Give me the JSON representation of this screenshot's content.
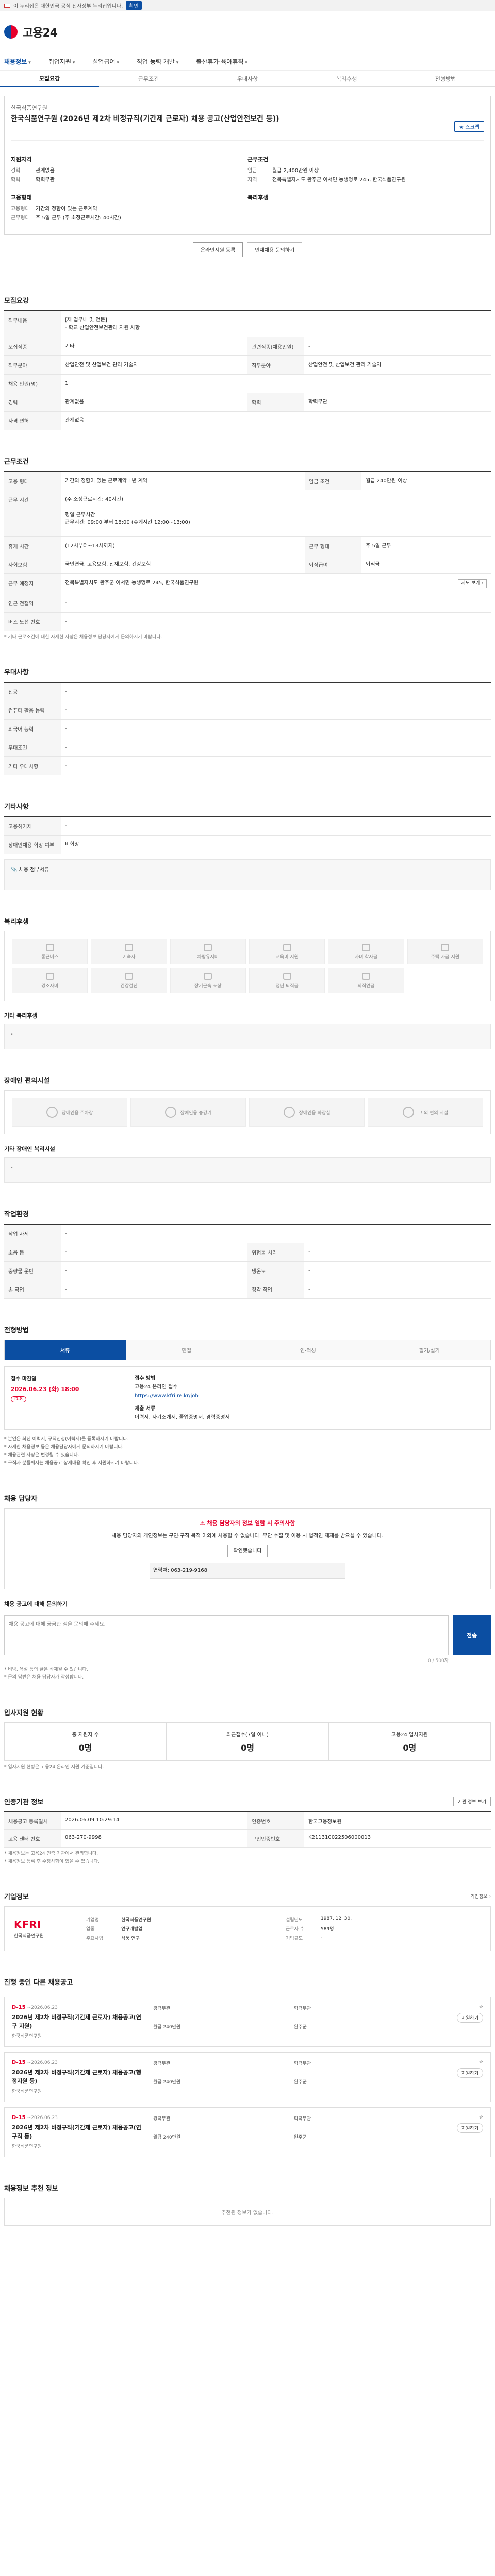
{
  "banner": {
    "text": "이 누리집은 대한민국 공식 전자정부 누리집입니다.",
    "button": "확인"
  },
  "logo": {
    "text": "고용24"
  },
  "gnb": [
    "채용정보",
    "취업지원",
    "실업급여",
    "직업 능력 개발",
    "출산휴가·육아휴직"
  ],
  "tabs": [
    "모집요강",
    "근무조건",
    "우대사항",
    "복리후생",
    "전형방법"
  ],
  "title": {
    "company": "한국식품연구원",
    "text": "한국식품연구원 (2026년 제2차 비정규직(기간제 근로자) 채용 공고(산업안전보건 등))",
    "scrap": "★ 스크랩"
  },
  "summary": {
    "recruit_h": "지원자격",
    "recruit": [
      {
        "k": "경력",
        "v": "관계없음"
      },
      {
        "k": "학력",
        "v": "학력무관"
      }
    ],
    "cond_h": "근무조건",
    "cond": [
      {
        "k": "임금",
        "v": "월급 2,400만원 이상"
      },
      {
        "k": "지역",
        "v": "전북특별자치도 완주군 이서면 농생명로 245, 한국식품연구원"
      }
    ],
    "emp_h": "고용형태",
    "emp": [
      {
        "k": "고용형태",
        "v": "기간의 정함이 있는 근로계약"
      },
      {
        "k": "근무형태",
        "v": "주 5일 근무 (주 소정근로시간: 40시간)"
      }
    ],
    "welfare_h": "복리후생",
    "welfare": []
  },
  "buttons": {
    "apply": "온라인지원 등록",
    "inquire": "인재채용 문의하기"
  },
  "recruit": {
    "heading": "모집요강",
    "duty_label": "직무내용",
    "duty": "[제 업무내 및 전문]\n- 학교 산업안전보건관리 지원 사항",
    "rows": [
      {
        "k": "모집직종",
        "v": "기타",
        "k2": "관련직종(채용인원)",
        "v2": "-"
      },
      {
        "k": "직무분야",
        "v": "산업안전 및 산업보건 관리 기술자",
        "k2": "직무분야",
        "v2": "산업안전 및 산업보건 관리 기술자"
      },
      {
        "k": "채용 인원(명)",
        "v": "1",
        "k2": "",
        "v2": ""
      },
      {
        "k": "경력",
        "v": "관계없음",
        "k2": "학력",
        "v2": "학력무관"
      },
      {
        "k": "자격 면허",
        "v": "관계없음",
        "k2": "",
        "v2": ""
      }
    ]
  },
  "work": {
    "heading": "근무조건",
    "rows": [
      {
        "k": "고용 형태",
        "v": "기간의 정함이 있는 근로계약 1년 계약",
        "k2": "임금 조건",
        "v2": "월급 240만원 이상"
      },
      {
        "k": "근무 시간",
        "v": "(주 소정근로시간: 40시간)\n\n평일 근무시간\n근무시간: 09:00 부터 18:00 (휴게시간 12:00~13:00)"
      },
      {
        "k": "휴게 시간",
        "v": "(12시부터~13시까지)",
        "k2": "근무 형태",
        "v2": "주 5일 근무"
      },
      {
        "k": "사회보험",
        "v": "국민연금, 고용보험, 산재보험, 건강보험",
        "k2": "퇴직급여",
        "v2": "퇴직금"
      },
      {
        "k": "근무 예정지",
        "v": "전북특별자치도 완주군 이서면 농생명로 245, 한국식품연구원",
        "k2": "",
        "v2": ""
      },
      {
        "k": "인근 전철역",
        "v": "-",
        "k2": "",
        "v2": ""
      },
      {
        "k": "버스 노선 번호",
        "v": "-",
        "k2": "",
        "v2": ""
      }
    ],
    "note": "* 기타 근로조건에 대한 자세한 사항은 채용정보 담당자에게 문의하시기 바랍니다.",
    "map_button": "지도 보기 ›"
  },
  "prefer": {
    "heading": "우대사항",
    "rows": [
      {
        "k": "전공",
        "v": "-"
      },
      {
        "k": "컴퓨터 활용 능력",
        "v": "-"
      },
      {
        "k": "외국어 능력",
        "v": "-"
      },
      {
        "k": "우대조건",
        "v": "-"
      },
      {
        "k": "기타 우대사항",
        "v": "-"
      }
    ]
  },
  "extra": {
    "heading": "기타사항",
    "rows": [
      {
        "k": "고용허가제",
        "v": "-"
      },
      {
        "k": "장애인채용 희망 여부",
        "v": "비희망"
      }
    ],
    "attach_label": "채용 첨부서류"
  },
  "benefit": {
    "heading": "복리후생",
    "items": [
      "통근버스",
      "기숙사",
      "차량유지비",
      "교육비 지원",
      "자녀 학자금",
      "주택 자금 지원",
      "경조사비",
      "건강검진",
      "장기근속 포상",
      "정년 퇴직금",
      "퇴직연금"
    ],
    "other_label": "기타 복리후생",
    "other": "-"
  },
  "disability": {
    "heading": "장애인 편의시설",
    "items": [
      "장애인용 주차장",
      "장애인용 승강기",
      "장애인용 화장실",
      "그 외 편의 시설"
    ],
    "other_label": "기타 장애인 복리시설",
    "other": "-"
  },
  "env": {
    "heading": "작업환경",
    "rows": [
      {
        "k": "작업 자세",
        "v": "-",
        "k2": "",
        "v2": ""
      },
      {
        "k": "소음 등",
        "v": "-",
        "k2": "위험물 처리",
        "v2": "-"
      },
      {
        "k": "중량물 운반",
        "v": "-",
        "k2": "냉온도",
        "v2": "-"
      },
      {
        "k": "손 작업",
        "v": "-",
        "k2": "청각 작업",
        "v2": "-"
      }
    ]
  },
  "select": {
    "heading": "전형방법",
    "steps": [
      "서류",
      "면접",
      "인·적성",
      "필기/실기"
    ],
    "period_label": "접수 마감일",
    "period": "2026.06.23 (화) 18:00",
    "dday": "D-8",
    "method_label": "접수 방법",
    "method": "고용24 온라인 접수",
    "url": "https://www.kfri.re.kr/job",
    "docs_label": "제출 서류",
    "docs": "이력서, 자기소개서, 졸업증명서, 경력증명서",
    "notes": [
      "* 본인은 최신 이력서, 구직신청(이력서)를 등록하시기 바랍니다.",
      "* 자세한 채용정보 등은 채용담당자에게 문의하시기 바랍니다.",
      "* 채용관련 사항은 변경될 수 있습니다.",
      "* 구직자 분들께서는 채용공고 상세내용 확인 후 지원하시기 바랍니다."
    ]
  },
  "contact": {
    "heading": "채용 담당자",
    "warn": "채용 담당자의 정보 열람 시 주의사항",
    "text": "채용 담당자의 개인정보는 구인·구직 목적 이외에 사용할 수 없습니다. 무단 수집 및 이용 시 법적인 제재를 받으실 수 있습니다.",
    "check": "확인했습니다",
    "phone": "연락처: 063-219-9168"
  },
  "inquiry": {
    "heading": "채용 공고에 대해 문의하기",
    "placeholder": "채용 공고에 대해 궁금한 점을 문의해 주세요.",
    "count": "0 / 500자",
    "send": "전송",
    "note1": "* 비방, 욕설 등의 글은 삭제될 수 있습니다.",
    "note2": "* 문의 답변은 채용 담당자가 작성합니다."
  },
  "stats": {
    "heading": "입사지원 현황",
    "items": [
      {
        "label": "총 지원자 수",
        "num": "0명"
      },
      {
        "label": "최근접수(7일 이내)",
        "num": "0명"
      },
      {
        "label": "고용24 입사지원",
        "num": "0명"
      }
    ],
    "note": "* 입사지원 현황은 고용24 온라인 지원 기준입니다."
  },
  "mgmt": {
    "heading": "인증기관 정보",
    "button": "기관 정보 보기",
    "rows": [
      {
        "k": "채용공고 등록일시",
        "v": "2026.06.09 10:29:14",
        "k2": "인증번호",
        "v2": "한국고용정보원"
      },
      {
        "k": "고용 센터 번호",
        "v": "063-270-9998",
        "k2": "구인인증번호",
        "v2": "K211310022506000013"
      }
    ],
    "notes": [
      "* 채용정보는 고용24 인증 기관에서 관리합니다.",
      "* 채용정보 등록 후 수정사항이 있을 수 있습니다."
    ]
  },
  "company": {
    "heading": "기업정보",
    "more": "기업정보 ›",
    "logo": "KFRI",
    "logo_sub": "한국식품연구원",
    "rows": [
      {
        "k": "기업명",
        "v": "한국식품연구원"
      },
      {
        "k": "업종",
        "v": "연구개발업"
      },
      {
        "k": "주요사업",
        "v": "식품 연구"
      },
      {
        "k": "설립년도",
        "v": "1987. 12. 30."
      },
      {
        "k": "근로자 수",
        "v": "589명"
      },
      {
        "k": "기업규모",
        "v": "-"
      }
    ]
  },
  "related": {
    "heading": "진행 중인 다른 채용공고",
    "items": [
      {
        "dday": "D-15",
        "date": "~2026.06.23",
        "title": "2026년 제2차 비정규직(기간제 근로자) 채용공고(연구 지원)",
        "company": "한국식품연구원",
        "tags": [
          "경력무관",
          "학력무관",
          "월급 240만원",
          "완주군"
        ],
        "btn": "지원하기"
      },
      {
        "dday": "D-15",
        "date": "~2026.06.23",
        "title": "2026년 제2차 비정규직(기간제 근로자) 채용공고(행정지원 등)",
        "company": "한국식품연구원",
        "tags": [
          "경력무관",
          "학력무관",
          "월급 240만원",
          "완주군"
        ],
        "btn": "지원하기"
      },
      {
        "dday": "D-15",
        "date": "~2026.06.23",
        "title": "2026년 제2차 비정규직(기간제 근로자) 채용공고(연구직 등)",
        "company": "한국식품연구원",
        "tags": [
          "경력무관",
          "학력무관",
          "월급 240만원",
          "완주군"
        ],
        "btn": "지원하기"
      }
    ]
  },
  "recommend": {
    "heading": "채용정보 추천 정보",
    "empty": "추천된 정보가 없습니다."
  }
}
